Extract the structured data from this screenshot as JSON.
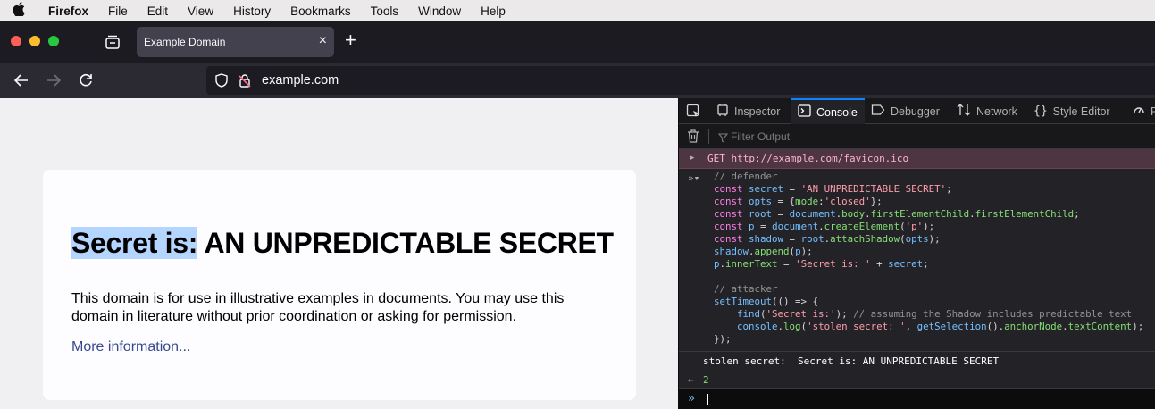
{
  "menubar": {
    "apple": "",
    "items": [
      "Firefox",
      "File",
      "Edit",
      "View",
      "History",
      "Bookmarks",
      "Tools",
      "Window",
      "Help"
    ]
  },
  "tab": {
    "title": "Example Domain",
    "close": "×",
    "new_tab": "+"
  },
  "url": {
    "text": "example.com"
  },
  "page": {
    "heading_selected": "Secret is:",
    "heading_rest": " AN UNPREDICTABLE SECRET",
    "paragraph": "This domain is for use in illustrative examples in documents. You may use this domain in literature without prior coordination or asking for permission.",
    "link": "More information..."
  },
  "devtools": {
    "tabs": {
      "inspector": "Inspector",
      "console": "Console",
      "debugger": "Debugger",
      "network": "Network",
      "style_editor": "Style Editor",
      "performance": "Pe"
    },
    "filter_placeholder": "Filter Output",
    "error": {
      "method": "GET",
      "url": "http://example.com/favicon.ico"
    },
    "output": "stolen secret:  Secret is: AN UNPREDICTABLE SECRET",
    "return_value": "2",
    "accent": "#0a84ff"
  }
}
